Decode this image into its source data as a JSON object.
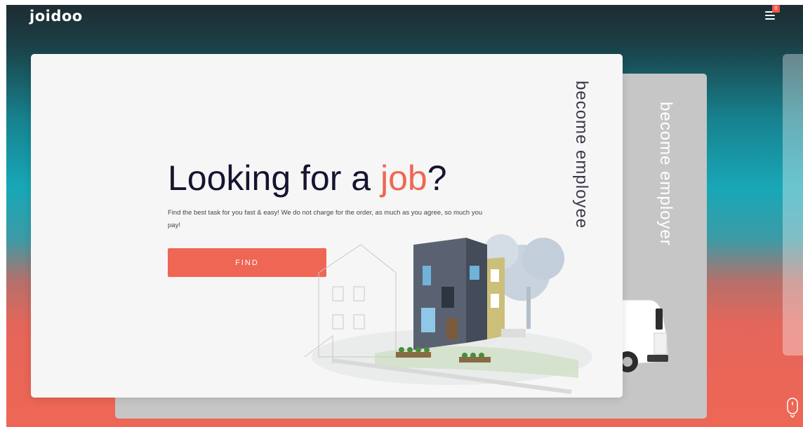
{
  "header": {
    "logo_text": "joidoo",
    "menu_badge": "0"
  },
  "cards": {
    "main": {
      "side_label": "become employee",
      "headline_prefix": "Looking for a ",
      "headline_accent": "job",
      "headline_suffix": "?",
      "description": "Find the best task for you fast & easy! We do not charge for the order, as much as you agree, so much you pay!",
      "button_label": "FIND"
    },
    "back": {
      "side_label": "become employer"
    }
  },
  "colors": {
    "accent": "#ef6654",
    "headline": "#151530",
    "card_back": "#c6c6c6"
  },
  "icons": {
    "menu": "hamburger-menu-icon",
    "scroll": "mouse-scroll-icon"
  }
}
